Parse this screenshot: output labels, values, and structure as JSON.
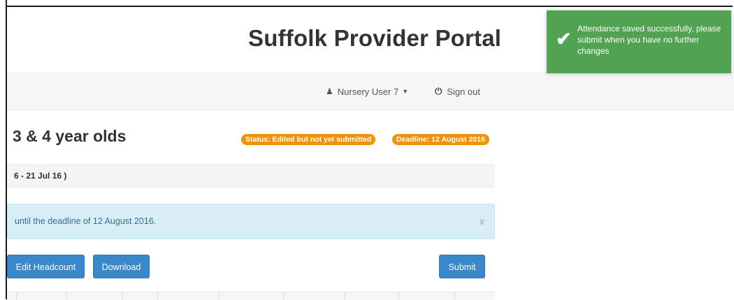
{
  "header": {
    "title": "Suffolk Provider Portal"
  },
  "navbar": {
    "user_icon": "user-icon",
    "user_label": "Nursery User 7",
    "signout_icon": "power-icon",
    "signout_label": "Sign out"
  },
  "page": {
    "heading": "3 & 4 year olds",
    "status_badge": "Status: Edited but not yet submitted",
    "deadline_badge": "Deadline: 12 August 2016",
    "period": "6 - 21 Jul 16 )"
  },
  "alert": {
    "text": "until the deadline of 12 August 2016.",
    "close_label": "x"
  },
  "buttons": {
    "edit_headcount": "Edit Headcount",
    "download": "Download",
    "submit": "Submit"
  },
  "toast": {
    "icon": "check-icon",
    "message": "Attendance saved successfully, please submit when you have no further changes"
  },
  "colors": {
    "primary_button": "#3a87c9",
    "badge": "#f0930b",
    "toast": "#51a351",
    "info_bg": "#d9edf7",
    "info_text": "#31708f"
  }
}
